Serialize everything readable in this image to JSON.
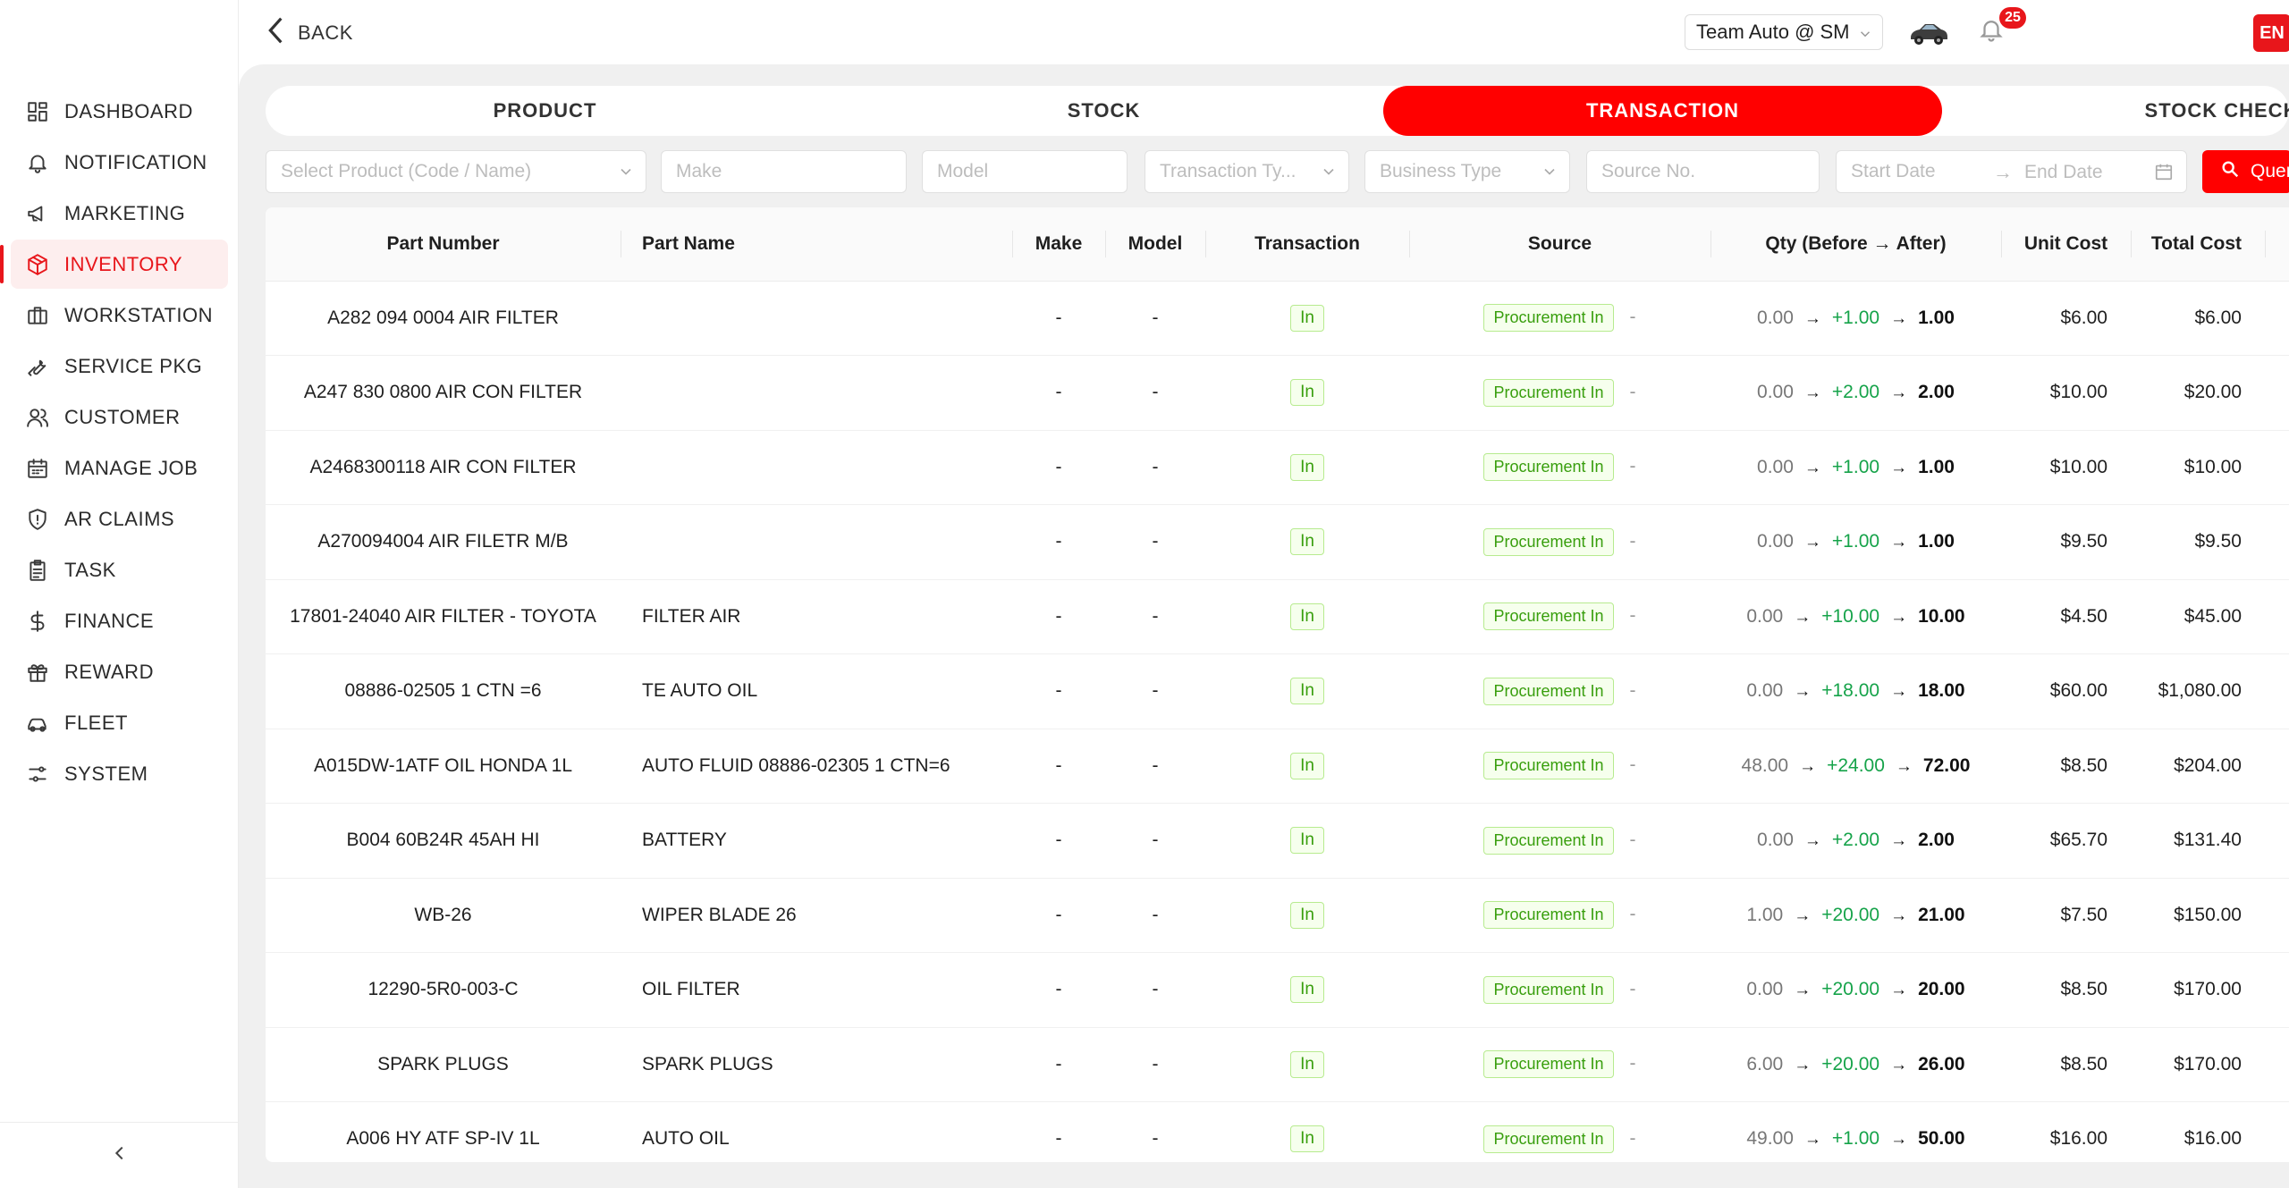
{
  "sidebar": {
    "items": [
      {
        "label": "DASHBOARD",
        "icon": "dashboard-icon"
      },
      {
        "label": "NOTIFICATION",
        "icon": "bell-icon"
      },
      {
        "label": "MARKETING",
        "icon": "megaphone-icon"
      },
      {
        "label": "INVENTORY",
        "icon": "box-icon",
        "active": true
      },
      {
        "label": "WORKSTATION",
        "icon": "briefcase-icon"
      },
      {
        "label": "SERVICE PKG",
        "icon": "wrench-icon"
      },
      {
        "label": "CUSTOMER",
        "icon": "users-icon"
      },
      {
        "label": "MANAGE JOB",
        "icon": "calendar-icon"
      },
      {
        "label": "AR CLAIMS",
        "icon": "shield-icon"
      },
      {
        "label": "TASK",
        "icon": "clipboard-icon"
      },
      {
        "label": "FINANCE",
        "icon": "dollar-icon"
      },
      {
        "label": "REWARD",
        "icon": "gift-icon"
      },
      {
        "label": "FLEET",
        "icon": "car-icon"
      },
      {
        "label": "SYSTEM",
        "icon": "sliders-icon"
      }
    ],
    "collapse_icon": "chevron-left-icon"
  },
  "topbar": {
    "back_label": "BACK",
    "team": "Team Auto @ SM",
    "notification_count": "25",
    "language": "EN"
  },
  "tabs": [
    {
      "label": "PRODUCT"
    },
    {
      "label": "STOCK"
    },
    {
      "label": "TRANSACTION",
      "active": true
    },
    {
      "label": "STOCK CHECK"
    }
  ],
  "filters": {
    "product_placeholder": "Select Product (Code / Name)",
    "make_placeholder": "Make",
    "model_placeholder": "Model",
    "transaction_type_placeholder": "Transaction Ty...",
    "business_type_placeholder": "Business Type",
    "source_no_placeholder": "Source No.",
    "start_date_placeholder": "Start Date",
    "end_date_placeholder": "End Date",
    "query_label": "Query"
  },
  "table": {
    "columns": [
      "Part Number",
      "Part Name",
      "Make",
      "Model",
      "Transaction",
      "Source",
      "Qty (Before → After)",
      "Unit Cost",
      "Total Cost"
    ],
    "rows": [
      {
        "part_number": "A282 094 0004 AIR FILTER",
        "part_name": "",
        "make": "-",
        "model": "-",
        "transaction": "In",
        "source": "Procurement In",
        "source_no": "-",
        "before": "0.00",
        "change": "+1.00",
        "after": "1.00",
        "unit_cost": "$6.00",
        "total_cost": "$6.00"
      },
      {
        "part_number": "A247 830 0800 AIR CON FILTER",
        "part_name": "",
        "make": "-",
        "model": "-",
        "transaction": "In",
        "source": "Procurement In",
        "source_no": "-",
        "before": "0.00",
        "change": "+2.00",
        "after": "2.00",
        "unit_cost": "$10.00",
        "total_cost": "$20.00"
      },
      {
        "part_number": "A2468300118 AIR CON FILTER",
        "part_name": "",
        "make": "-",
        "model": "-",
        "transaction": "In",
        "source": "Procurement In",
        "source_no": "-",
        "before": "0.00",
        "change": "+1.00",
        "after": "1.00",
        "unit_cost": "$10.00",
        "total_cost": "$10.00"
      },
      {
        "part_number": "A270094004 AIR FILETR M/B",
        "part_name": "",
        "make": "-",
        "model": "-",
        "transaction": "In",
        "source": "Procurement In",
        "source_no": "-",
        "before": "0.00",
        "change": "+1.00",
        "after": "1.00",
        "unit_cost": "$9.50",
        "total_cost": "$9.50"
      },
      {
        "part_number": "17801-24040 AIR FILTER - TOYOTA",
        "part_name": "FILTER AIR",
        "make": "-",
        "model": "-",
        "transaction": "In",
        "source": "Procurement In",
        "source_no": "-",
        "before": "0.00",
        "change": "+10.00",
        "after": "10.00",
        "unit_cost": "$4.50",
        "total_cost": "$45.00"
      },
      {
        "part_number": "08886-02505 1 CTN =6",
        "part_name": "TE AUTO OIL",
        "make": "-",
        "model": "-",
        "transaction": "In",
        "source": "Procurement In",
        "source_no": "-",
        "before": "0.00",
        "change": "+18.00",
        "after": "18.00",
        "unit_cost": "$60.00",
        "total_cost": "$1,080.00"
      },
      {
        "part_number": "A015DW-1ATF OIL HONDA 1L",
        "part_name": "AUTO FLUID 08886-02305 1 CTN=6",
        "make": "-",
        "model": "-",
        "transaction": "In",
        "source": "Procurement In",
        "source_no": "-",
        "before": "48.00",
        "change": "+24.00",
        "after": "72.00",
        "unit_cost": "$8.50",
        "total_cost": "$204.00"
      },
      {
        "part_number": "B004 60B24R 45AH HI",
        "part_name": "BATTERY",
        "make": "-",
        "model": "-",
        "transaction": "In",
        "source": "Procurement In",
        "source_no": "-",
        "before": "0.00",
        "change": "+2.00",
        "after": "2.00",
        "unit_cost": "$65.70",
        "total_cost": "$131.40"
      },
      {
        "part_number": "WB-26",
        "part_name": "WIPER BLADE 26",
        "make": "-",
        "model": "-",
        "transaction": "In",
        "source": "Procurement In",
        "source_no": "-",
        "before": "1.00",
        "change": "+20.00",
        "after": "21.00",
        "unit_cost": "$7.50",
        "total_cost": "$150.00"
      },
      {
        "part_number": "12290-5R0-003-C",
        "part_name": "OIL FILTER",
        "make": "-",
        "model": "-",
        "transaction": "In",
        "source": "Procurement In",
        "source_no": "-",
        "before": "0.00",
        "change": "+20.00",
        "after": "20.00",
        "unit_cost": "$8.50",
        "total_cost": "$170.00"
      },
      {
        "part_number": "SPARK PLUGS",
        "part_name": "SPARK PLUGS",
        "make": "-",
        "model": "-",
        "transaction": "In",
        "source": "Procurement In",
        "source_no": "-",
        "before": "6.00",
        "change": "+20.00",
        "after": "26.00",
        "unit_cost": "$8.50",
        "total_cost": "$170.00"
      },
      {
        "part_number": "A006 HY ATF SP-IV 1L",
        "part_name": "AUTO OIL",
        "make": "-",
        "model": "-",
        "transaction": "In",
        "source": "Procurement In",
        "source_no": "-",
        "before": "49.00",
        "change": "+1.00",
        "after": "50.00",
        "unit_cost": "$16.00",
        "total_cost": "$16.00"
      }
    ]
  },
  "colors": {
    "accent": "#e8161b",
    "tab_active": "#ff0000",
    "tag_green": "#389e0d"
  }
}
